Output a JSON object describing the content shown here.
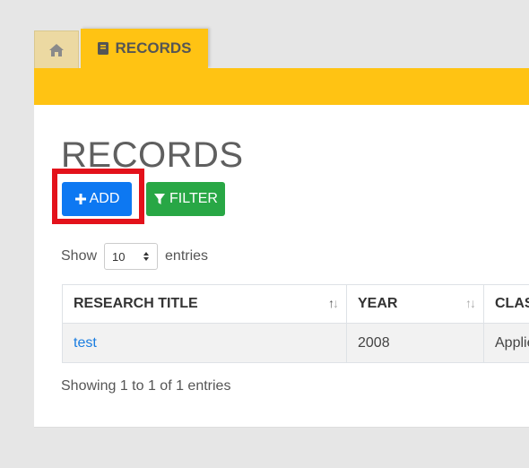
{
  "tabs": {
    "home_icon": "home-icon",
    "records_label": "RECORDS",
    "records_icon": "book-icon"
  },
  "page": {
    "title": "RECORDS"
  },
  "toolbar": {
    "add_label": "ADD",
    "filter_label": "FILTER"
  },
  "length": {
    "show_label": "Show",
    "value": "10",
    "entries_label": "entries"
  },
  "table": {
    "headers": [
      "RESEARCH TITLE",
      "YEAR",
      "CLAS"
    ],
    "rows": [
      {
        "title": "test",
        "year": "2008",
        "classification": "Applie"
      }
    ]
  },
  "info": "Showing 1 to 1 of 1 entries",
  "colors": {
    "accent_yellow": "#ffc313",
    "add_blue": "#0d78f2",
    "filter_green": "#28a745",
    "highlight_red": "#e3121b"
  }
}
